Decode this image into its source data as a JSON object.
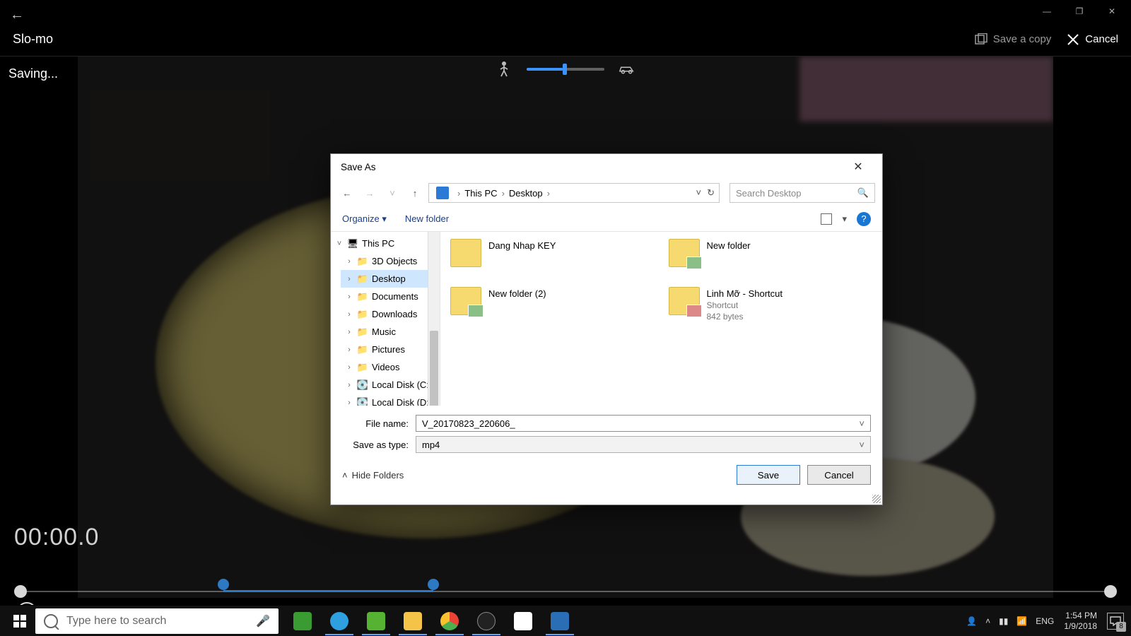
{
  "titlebar": {
    "minimize": "—",
    "maximize": "❐",
    "close": "✕"
  },
  "app": {
    "back": "←",
    "mode": "Slo-mo",
    "save_copy": "Save a copy",
    "cancel": "Cancel",
    "status": "Saving...",
    "timecode": "00:00.0"
  },
  "dialog": {
    "title": "Save As",
    "breadcrumb": {
      "root": "This PC",
      "leaf": "Desktop"
    },
    "search_placeholder": "Search Desktop",
    "toolbar": {
      "organize": "Organize ▾",
      "newfolder": "New folder"
    },
    "tree": [
      {
        "label": "This PC",
        "expanded": true,
        "icon": "pc"
      },
      {
        "label": "3D Objects",
        "icon": "folder"
      },
      {
        "label": "Desktop",
        "icon": "folder",
        "selected": true
      },
      {
        "label": "Documents",
        "icon": "folder"
      },
      {
        "label": "Downloads",
        "icon": "folder"
      },
      {
        "label": "Music",
        "icon": "folder"
      },
      {
        "label": "Pictures",
        "icon": "folder"
      },
      {
        "label": "Videos",
        "icon": "folder"
      },
      {
        "label": "Local Disk (C:)",
        "icon": "drive"
      },
      {
        "label": "Local Disk (D:)",
        "icon": "drive"
      }
    ],
    "files": [
      {
        "name": "Dang Nhap KEY"
      },
      {
        "name": "New folder",
        "showpic": true
      },
      {
        "name": "New folder (2)",
        "showpic": true
      },
      {
        "name": "Linh Mỡ - Shortcut",
        "sub1": "Shortcut",
        "sub2": "842 bytes",
        "showpic": true
      }
    ],
    "fields": {
      "fname_label": "File name:",
      "fname_value": "V_20170823_220606_",
      "ftype_label": "Save as type:",
      "ftype_value": "mp4"
    },
    "hide_folders": "Hide Folders",
    "save": "Save",
    "cancel": "Cancel"
  },
  "taskbar": {
    "search_placeholder": "Type here to search",
    "lang": "ENG",
    "time": "1:54 PM",
    "date": "1/9/2018",
    "notif_count": "8"
  }
}
